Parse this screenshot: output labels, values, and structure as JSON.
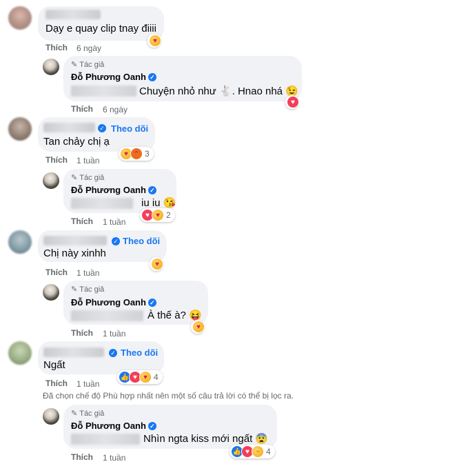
{
  "like_label": "Thích",
  "follow_label": "Theo dõi",
  "author_tag": "Tác giả",
  "author_name": "Đỗ Phương Oanh",
  "comments": [
    {
      "text": "Dạy e quay clip tnay điiii",
      "time": "6 ngày",
      "reply": {
        "text": "Chuyện nhỏ như 🐇. Hnao nhá 😉",
        "time": "6 ngày"
      }
    },
    {
      "text": "Tan chảy chị ạ",
      "time": "1 tuần",
      "reaction_count": "3",
      "reply": {
        "text": "iu iu 😘",
        "time": "1 tuần",
        "reaction_count": "2"
      }
    },
    {
      "text": "Chị này xinhh",
      "time": "1 tuần",
      "reply": {
        "text": "À thế à? 😝",
        "time": "1 tuần"
      }
    },
    {
      "text": "Ngất",
      "time": "1 tuần",
      "reaction_count": "4",
      "reply": {
        "text": "Nhìn ngta kiss mới ngất 😨",
        "time": "1 tuần",
        "reaction_count": "4"
      }
    }
  ],
  "filter_notice": "Đã chọn chế độ Phù hợp nhất nên một số câu trả lời có thể bị lọc ra.",
  "colors": {
    "link_blue": "#1877f2",
    "bubble_gray": "#f0f2f5",
    "meta_gray": "#65676b",
    "love_red": "#f33e58"
  }
}
